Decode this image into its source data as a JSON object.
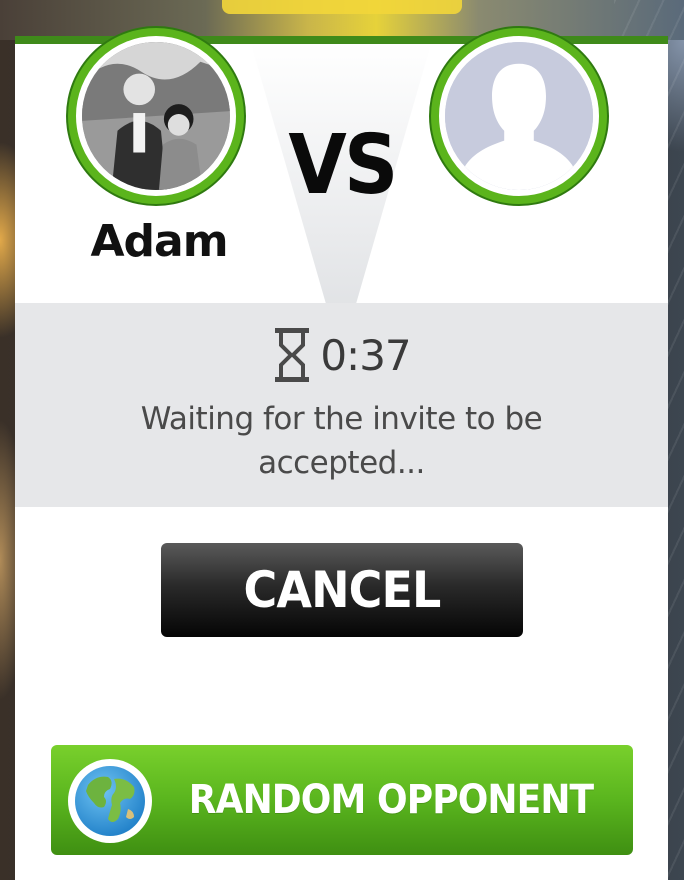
{
  "match": {
    "player": {
      "name": "Adam",
      "avatar": "player-photo"
    },
    "opponent": {
      "name": "",
      "avatar": "default-silhouette"
    },
    "versus_label": "VS"
  },
  "waiting": {
    "timer_icon": "hourglass-icon",
    "timer": "0:37",
    "message": "Waiting for the invite to be accepted..."
  },
  "actions": {
    "cancel_label": "CANCEL",
    "random_label": "RANDOM OPPONENT",
    "random_icon": "globe-icon"
  },
  "colors": {
    "accent_green": "#5bb41c",
    "dark_green": "#3f8a1a",
    "panel_gray": "#e6e7e9",
    "button_black": "#050505"
  }
}
